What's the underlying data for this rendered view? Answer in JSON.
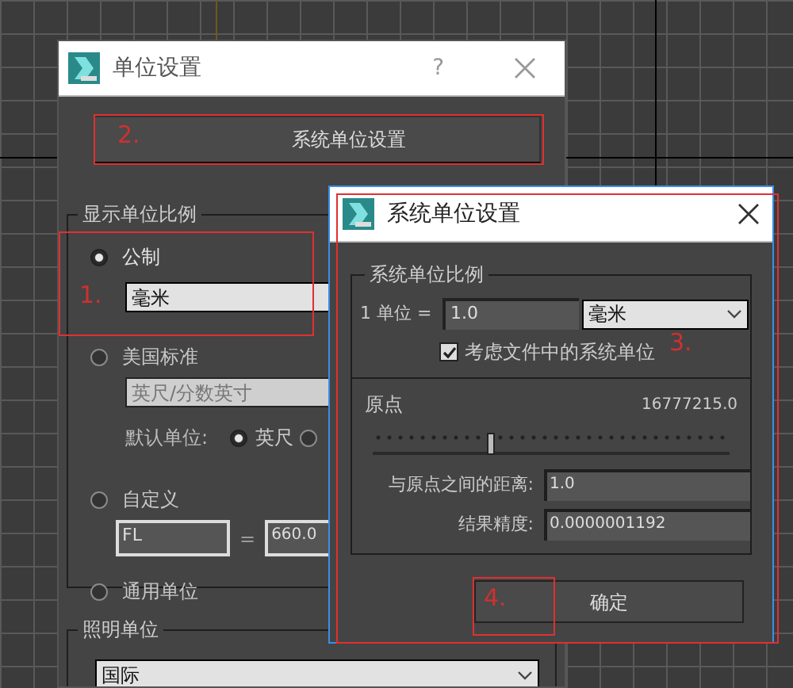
{
  "main_dialog": {
    "title": "单位设置",
    "help": "?",
    "system_units_button": "系统单位设置",
    "display_scale": {
      "title": "显示单位比例",
      "options": [
        {
          "label": "公制",
          "selected": true
        },
        {
          "label": "美国标准",
          "selected": false
        },
        {
          "label": "自定义",
          "selected": false
        },
        {
          "label": "通用单位",
          "selected": false
        }
      ],
      "metric_unit": "毫米",
      "us_unit": "英尺/分数英寸",
      "default_unit_label": "默认单位:",
      "default_units": [
        {
          "label": "英尺",
          "selected": true
        },
        {
          "selected": false
        }
      ],
      "custom_name": "FL",
      "equals": "=",
      "custom_value": "660.0"
    },
    "lighting": {
      "title": "照明单位",
      "value": "国际"
    }
  },
  "system_dialog": {
    "title": "系统单位设置",
    "group_title": "系统单位比例",
    "unit_label": "1 单位 =",
    "unit_value": "1.0",
    "unit": "毫米",
    "respect_file_units": {
      "label": "考虑文件中的系统单位",
      "checked": true
    },
    "origin_label": "原点",
    "origin_value": "16777215.0",
    "origin_slider": {
      "level": 0.33
    },
    "distance_label": "与原点之间的距离:",
    "distance_value": "1.0",
    "precision_label": "结果精度:",
    "precision_value": "0.0000001192",
    "ok_button": "确定"
  },
  "annotations": [
    {
      "label": "1."
    },
    {
      "label": "2."
    },
    {
      "label": "3."
    },
    {
      "label": "4."
    }
  ]
}
